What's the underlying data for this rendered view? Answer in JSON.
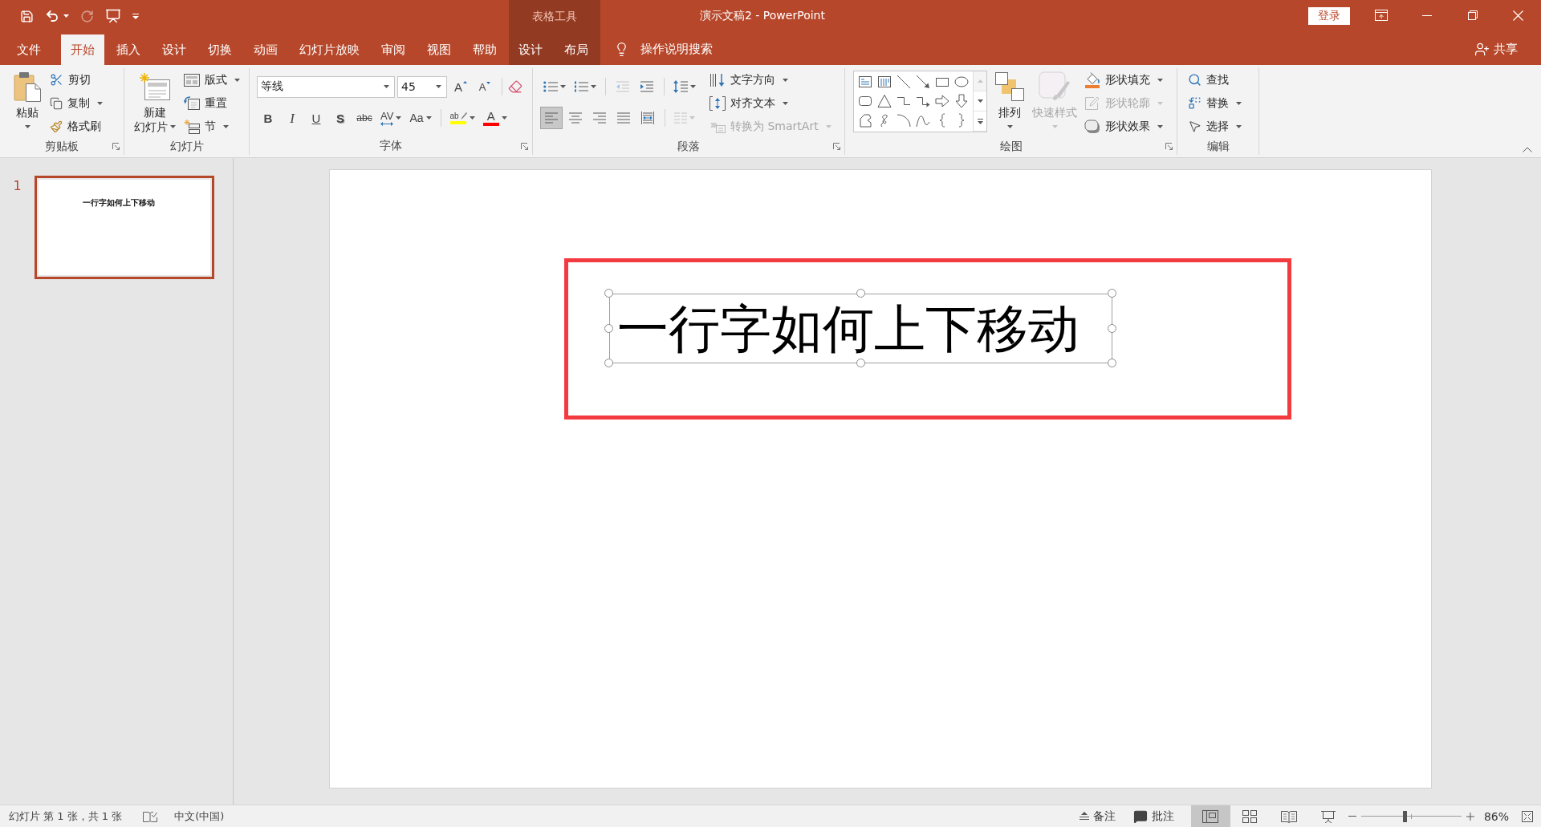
{
  "window": {
    "title": "演示文稿2 - PowerPoint",
    "context_label": "表格工具",
    "sign_in": "登录"
  },
  "quick_access": [
    {
      "kind": "save",
      "disabled": false,
      "dropdown": false
    },
    {
      "kind": "undo",
      "disabled": false,
      "dropdown": true
    },
    {
      "kind": "redo",
      "disabled": true,
      "dropdown": false
    },
    {
      "kind": "present",
      "disabled": false,
      "dropdown": false
    },
    {
      "kind": "customize",
      "disabled": false,
      "dropdown": false
    }
  ],
  "tabs": [
    {
      "label": "文件",
      "kind": "file",
      "selected": false
    },
    {
      "label": "开始",
      "kind": "standard",
      "selected": true
    },
    {
      "label": "插入",
      "kind": "standard",
      "selected": false
    },
    {
      "label": "设计",
      "kind": "standard",
      "selected": false
    },
    {
      "label": "切换",
      "kind": "standard",
      "selected": false
    },
    {
      "label": "动画",
      "kind": "standard",
      "selected": false
    },
    {
      "label": "幻灯片放映",
      "kind": "standard",
      "selected": false
    },
    {
      "label": "审阅",
      "kind": "standard",
      "selected": false
    },
    {
      "label": "视图",
      "kind": "standard",
      "selected": false
    },
    {
      "label": "帮助",
      "kind": "standard",
      "selected": false
    },
    {
      "label": "设计",
      "kind": "contextual",
      "selected": false
    },
    {
      "label": "布局",
      "kind": "contextual",
      "selected": false
    }
  ],
  "tell_me": "操作说明搜索",
  "share": "共享",
  "ribbon": {
    "clipboard": {
      "title": "剪贴板",
      "launcher": true,
      "paste": "粘贴",
      "commands": [
        {
          "kind": "cut",
          "label": "剪切",
          "dropdown": false
        },
        {
          "kind": "copy",
          "label": "复制",
          "dropdown": true
        },
        {
          "kind": "format_painter",
          "label": "格式刷",
          "dropdown": false
        }
      ]
    },
    "slides": {
      "title": "幻灯片",
      "launcher": false,
      "new_slide": [
        "新建",
        "幻灯片"
      ],
      "commands": [
        {
          "kind": "layout",
          "label": "版式",
          "dropdown": true
        },
        {
          "kind": "reset",
          "label": "重置",
          "dropdown": false
        },
        {
          "kind": "section",
          "label": "节",
          "dropdown": true
        }
      ]
    },
    "font": {
      "title": "字体",
      "launcher": true,
      "font_name": "等线",
      "font_size": "45",
      "size_tools": [
        {
          "kind": "grow",
          "glyph": "A"
        },
        {
          "kind": "shrink",
          "glyph": "A"
        }
      ],
      "format_tools": [
        {
          "kind": "bold",
          "glyph": "B",
          "dropdown": false
        },
        {
          "kind": "italic",
          "glyph": "I",
          "dropdown": false
        },
        {
          "kind": "underline",
          "glyph": "U",
          "dropdown": false
        },
        {
          "kind": "shadow",
          "glyph": "S",
          "dropdown": false
        },
        {
          "kind": "strikethrough",
          "glyph": "abc",
          "dropdown": false
        },
        {
          "kind": "spacing",
          "glyph": "AV",
          "dropdown": true
        },
        {
          "kind": "case",
          "glyph": "Aa",
          "dropdown": true
        }
      ],
      "color_tools": [
        {
          "kind": "highlight",
          "glyph": "ab",
          "color": "#ffff00"
        },
        {
          "kind": "font_color",
          "glyph": "A",
          "color": "#ff0000"
        }
      ]
    },
    "paragraph": {
      "title": "段落",
      "launcher": true,
      "list_tools": [
        {
          "kind": "bullets",
          "dropdown": true,
          "disabled": false
        },
        {
          "kind": "numbering",
          "dropdown": true,
          "disabled": false
        },
        {
          "kind": "decrease_indent",
          "dropdown": false,
          "disabled": true
        },
        {
          "kind": "increase_indent",
          "dropdown": false,
          "disabled": false
        },
        {
          "kind": "line_spacing",
          "dropdown": true,
          "disabled": false
        }
      ],
      "alignment": [
        {
          "kind": "left",
          "selected": true
        },
        {
          "kind": "center",
          "selected": false
        },
        {
          "kind": "right",
          "selected": false
        },
        {
          "kind": "justify",
          "selected": false
        },
        {
          "kind": "distributed",
          "selected": false
        }
      ],
      "columns": {
        "disabled": true
      },
      "commands": [
        {
          "kind": "text_direction",
          "label": "文字方向",
          "disabled": false
        },
        {
          "kind": "align_text",
          "label": "对齐文本",
          "disabled": false
        },
        {
          "kind": "smartart",
          "label": "转换为 SmartArt",
          "disabled": true
        }
      ]
    },
    "drawing": {
      "title": "绘图",
      "launcher": true,
      "arrange": "排列",
      "quick_styles": {
        "label": "快速样式",
        "disabled": true
      },
      "commands": [
        {
          "kind": "fill",
          "label": "形状填充",
          "disabled": false
        },
        {
          "kind": "outline",
          "label": "形状轮廓",
          "disabled": true
        },
        {
          "kind": "effects",
          "label": "形状效果",
          "disabled": false
        }
      ]
    },
    "editing": {
      "title": "编辑",
      "launcher": false,
      "commands": [
        {
          "kind": "find",
          "label": "查找",
          "dropdown": false
        },
        {
          "kind": "replace",
          "label": "替换",
          "dropdown": true
        },
        {
          "kind": "select",
          "label": "选择",
          "dropdown": true
        }
      ]
    }
  },
  "thumbnails": [
    {
      "number": "1",
      "title": "一行字如何上下移动",
      "selected": true
    }
  ],
  "slide": {
    "text_box": {
      "text": "一行字如何上下移动",
      "selected": true
    }
  },
  "status_bar": {
    "slide_info": "幻灯片 第 1 张，共 1 张",
    "language": "中文(中国)",
    "notes": "备注",
    "comments": "批注",
    "views": [
      {
        "kind": "normal",
        "selected": true
      },
      {
        "kind": "sorter",
        "selected": false
      },
      {
        "kind": "reading",
        "selected": false
      },
      {
        "kind": "slideshow",
        "selected": false
      }
    ],
    "zoom": {
      "level": 0.43,
      "reading": "86%"
    }
  }
}
